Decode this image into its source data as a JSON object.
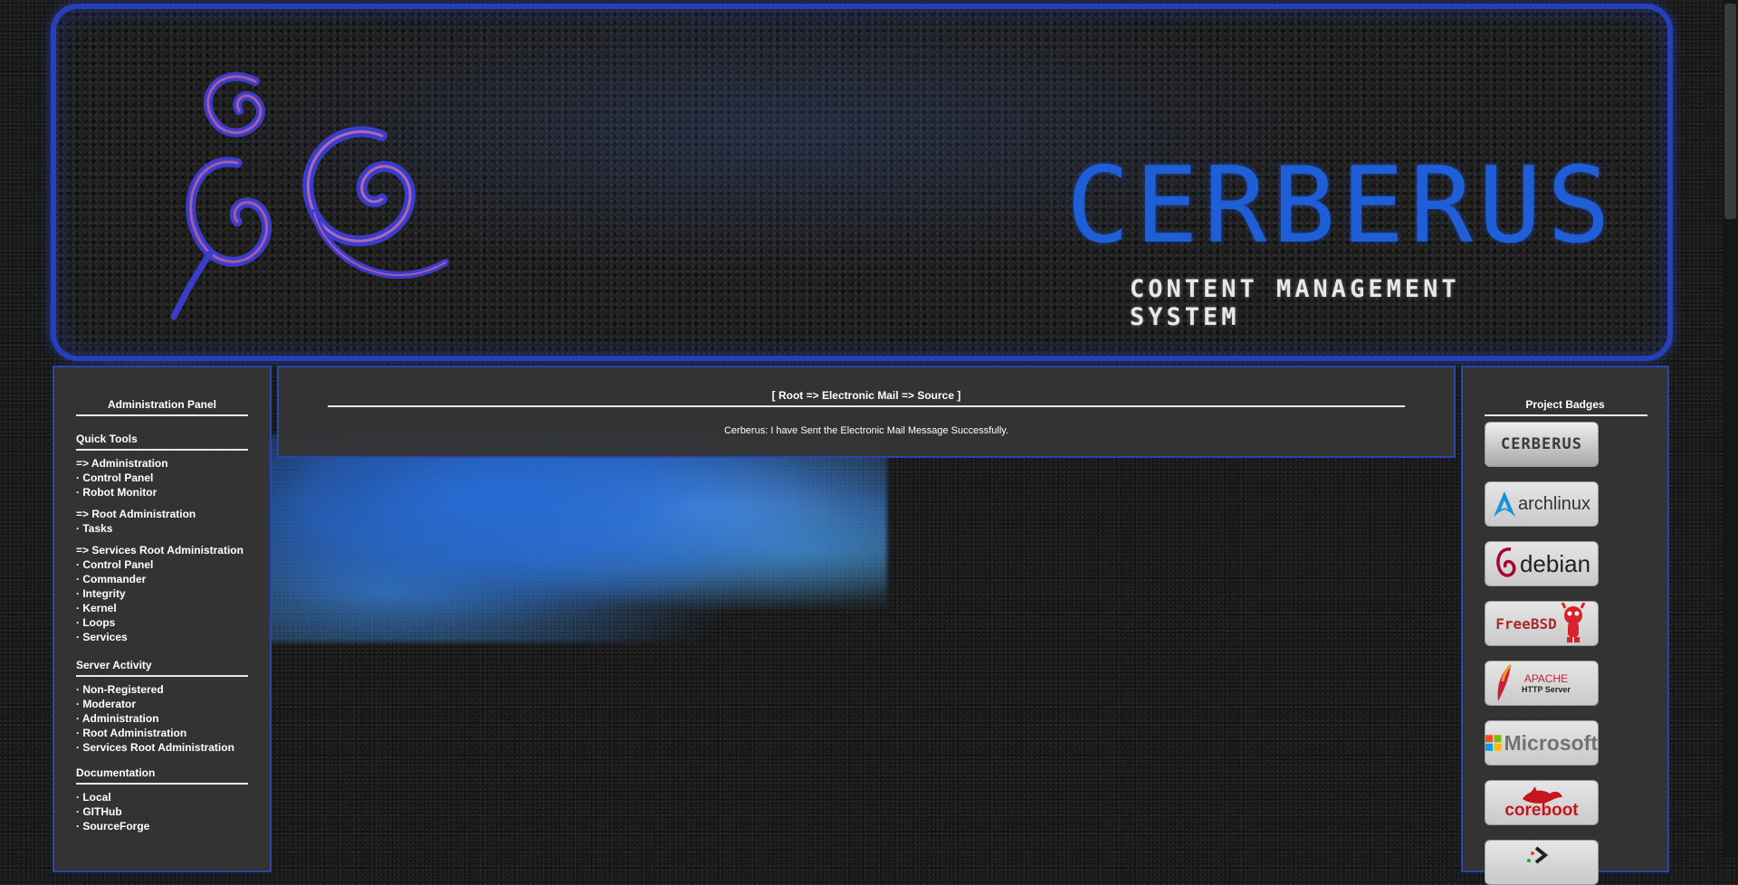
{
  "banner": {
    "title": "CERBERUS",
    "subtitle": "CONTENT MANAGEMENT SYSTEM",
    "colors": {
      "border": "#2540b8",
      "title": "#1e5fd8"
    }
  },
  "left_panel": {
    "heading": "Administration Panel",
    "quick_tools": {
      "title": "Quick Tools",
      "groups": [
        {
          "header": "=> Administration",
          "items": [
            "· Control Panel",
            "· Robot Monitor"
          ]
        },
        {
          "header": "=> Root Administration",
          "items": [
            "· Tasks"
          ]
        },
        {
          "header": "=> Services Root Administration",
          "items": [
            "· Control Panel",
            "· Commander",
            "· Integrity",
            "· Kernel",
            "· Loops",
            "· Services"
          ]
        }
      ]
    },
    "server_activity": {
      "title": "Server Activity",
      "items": [
        "· Non-Registered",
        "· Moderator",
        "· Administration",
        "· Root Administration",
        "· Services Root Administration"
      ]
    },
    "documentation": {
      "title": "Documentation",
      "items": [
        "· Local",
        "· GITHub",
        "· SourceForge"
      ]
    }
  },
  "center_panel": {
    "breadcrumb": "[ Root => Electronic Mail => Source ]",
    "message": "Cerberus: I have Sent the Electronic Mail Message Successfully."
  },
  "right_panel": {
    "heading": "Project Badges",
    "badges": [
      {
        "name": "cerberus",
        "label": "CERBERUS",
        "color": "#3a3a3a"
      },
      {
        "name": "archlinux",
        "label": "archlinux",
        "color": "#1793d1"
      },
      {
        "name": "debian",
        "label": "debian",
        "color": "#a80030"
      },
      {
        "name": "freebsd",
        "label": "FreeBSD",
        "color": "#ab2b28"
      },
      {
        "name": "apache",
        "label": "APACHE",
        "sublabel": "HTTP Server",
        "color": "#c92037"
      },
      {
        "name": "microsoft",
        "label": "Microsoft",
        "color": "#737373"
      },
      {
        "name": "coreboot",
        "label": "coreboot",
        "color": "#c4161c"
      }
    ]
  }
}
